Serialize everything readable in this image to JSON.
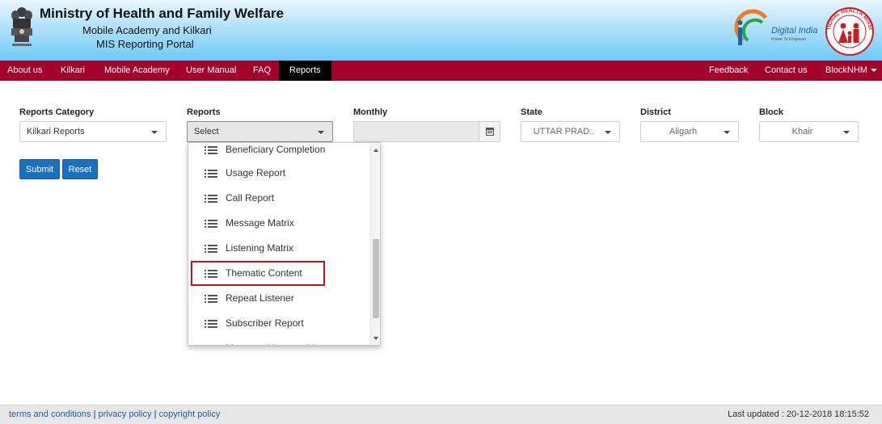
{
  "header": {
    "title": "Ministry of Health and Family Welfare",
    "subtitle_line1": "Mobile Academy and Kilkari",
    "subtitle_line2": "MIS Reporting Portal",
    "digital_india_text": "Digital India",
    "digital_india_tagline": "Power To Empower",
    "nhm_text": "NATIONAL HEALTH MISSION"
  },
  "navbar": {
    "items": [
      "About us",
      "Kilkari",
      "Mobile Academy",
      "User Manual",
      "FAQ",
      "Reports"
    ],
    "active": "Reports",
    "right_items": [
      "Feedback",
      "Contact us"
    ],
    "user": "BlockNHM"
  },
  "filters": {
    "reports_category": {
      "label": "Reports Category",
      "value": "Kilkari Reports"
    },
    "reports": {
      "label": "Reports",
      "value": "Select"
    },
    "monthly": {
      "label": "Monthly",
      "value": ""
    },
    "state": {
      "label": "State",
      "value": "UTTAR PRAD.."
    },
    "district": {
      "label": "District",
      "value": "Aligarh"
    },
    "block": {
      "label": "Block",
      "value": "Khair"
    }
  },
  "buttons": {
    "submit": "Submit",
    "reset": "Reset"
  },
  "dropdown": {
    "items": [
      "Beneficiary Completion",
      "Usage Report",
      "Call Report",
      "Message Matrix",
      "Listening Matrix",
      "Thematic Content",
      "Repeat Listener",
      "Subscriber Report",
      "Message Listenership"
    ],
    "highlighted": "Thematic Content"
  },
  "footer": {
    "links": [
      "terms and conditions",
      "privacy policy",
      "copyright policy"
    ],
    "separator": "|",
    "last_updated": "Last updated : 20-12-2018 18:15:52"
  },
  "colors": {
    "navbar": "#a3002a",
    "active_tab": "#000000",
    "button": "#1a6fbf",
    "highlight": "#c4121d",
    "link": "#1f5fa8"
  }
}
